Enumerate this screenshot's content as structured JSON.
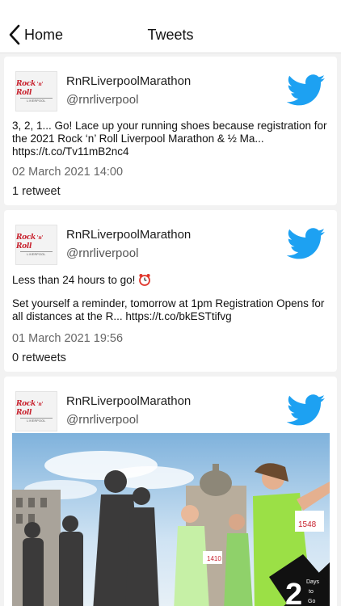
{
  "nav": {
    "back_label": "Home",
    "title": "Tweets"
  },
  "colors": {
    "twitter_blue": "#1DA1F2",
    "accent_red": "#c8222e"
  },
  "avatar": {
    "icon": "rnr-liverpool-logo",
    "logo_text": "Rock 'n' Roll",
    "logo_sub": "LIVERPOOL"
  },
  "tweets": [
    {
      "author": "RnRLiverpoolMarathon",
      "handle": "@rnrliverpool",
      "text": "3, 2, 1... Go! Lace up your running shoes because registration for the 2021 Rock ‘n’ Roll Liverpool Marathon & ½ Ma... https://t.co/Tv11mB2nc4",
      "date": "02 March 2021 14:00",
      "retweets": "1 retweet"
    },
    {
      "author": "RnRLiverpoolMarathon",
      "handle": "@rnrliverpool",
      "text_line1": "Less than 24 hours to go!",
      "text_line2": "Set yourself a reminder, tomorrow at 1pm Registration Opens for all distances at the R... https://t.co/bkESTtifvg",
      "date": "01 March 2021 19:56",
      "retweets": "0 retweets"
    },
    {
      "author": "RnRLiverpoolMarathon",
      "handle": "@rnrliverpool",
      "badge_number": "2",
      "badge_text_1": "Days",
      "badge_text_2": "to",
      "badge_text_3": "Go"
    }
  ]
}
